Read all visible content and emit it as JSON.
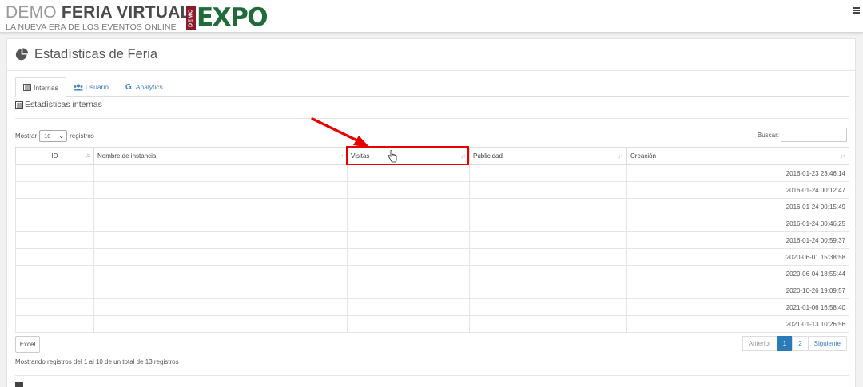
{
  "header": {
    "brand_light": "DEMO ",
    "brand_bold": "FERIA VIRTUAL",
    "brand_tagline": "LA NUEVA ERA DE LOS EVENTOS ONLINE",
    "expo_badge": "DEMO",
    "expo_text": "EXPO"
  },
  "page": {
    "title": "Estadísticas de Feria"
  },
  "tabs": [
    {
      "label": "Internas",
      "icon": "list-icon"
    },
    {
      "label": "Usuario",
      "icon": "users-icon"
    },
    {
      "label": "Analytics",
      "icon": "google-icon"
    }
  ],
  "section": {
    "title": "Estadísticas internas"
  },
  "controls": {
    "show_label": "Mostrar",
    "length_value": "10",
    "records_label": "registros",
    "search_label": "Buscar:",
    "search_value": ""
  },
  "table": {
    "columns": [
      "ID",
      "Nombre de instancia",
      "Visitas",
      "Publicidad",
      "Creación"
    ],
    "rows": [
      {
        "id": "",
        "name": "",
        "visits": "",
        "ads": "",
        "created": "2016-01-23 23:46:14"
      },
      {
        "id": "",
        "name": "",
        "visits": "",
        "ads": "",
        "created": "2016-01-24 00:12:47"
      },
      {
        "id": "",
        "name": "",
        "visits": "",
        "ads": "",
        "created": "2016-01-24 00:15:49"
      },
      {
        "id": "",
        "name": "",
        "visits": "",
        "ads": "",
        "created": "2016-01-24 00:46:25"
      },
      {
        "id": "",
        "name": "",
        "visits": "",
        "ads": "",
        "created": "2016-01-24 00:59:37"
      },
      {
        "id": "",
        "name": "",
        "visits": "",
        "ads": "",
        "created": "2020-06-01 15:38:58"
      },
      {
        "id": "",
        "name": "",
        "visits": "",
        "ads": "",
        "created": "2020-06-04 18:55:44"
      },
      {
        "id": "",
        "name": "",
        "visits": "",
        "ads": "",
        "created": "2020-10-26 19:09:57"
      },
      {
        "id": "",
        "name": "",
        "visits": "",
        "ads": "",
        "created": "2021-01-06 16:58:40"
      },
      {
        "id": "",
        "name": "",
        "visits": "",
        "ads": "",
        "created": "2021-01-13 10:26:56"
      }
    ]
  },
  "footer": {
    "excel_label": "Excel",
    "info": "Mostrando registros del 1 al 10 de un total de 13 registros",
    "prev": "Anterior",
    "pages": [
      "1",
      "2"
    ],
    "next": "Siguiente"
  },
  "colors": {
    "annotation_red": "#e60000",
    "link_blue": "#3c7fb8",
    "pagination_active": "#2b7bb9",
    "expo_green": "#1f6b3a",
    "expo_badge": "#8b1a2b"
  }
}
